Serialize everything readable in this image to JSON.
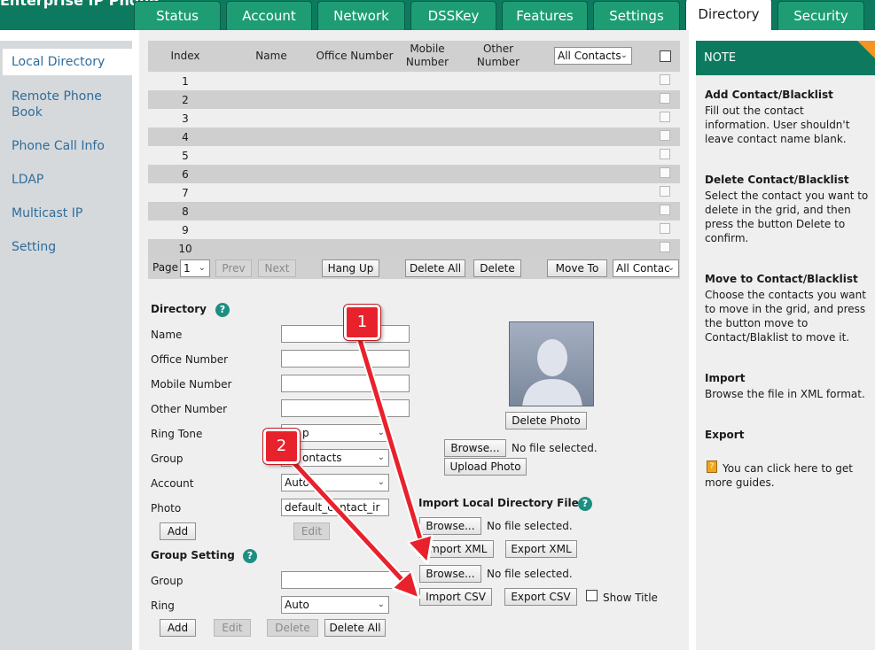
{
  "header": {
    "logo_text": "Enterprise IP Phone",
    "tabs": [
      "Status",
      "Account",
      "Network",
      "DSSKey",
      "Features",
      "Settings",
      "Directory",
      "Security"
    ],
    "active_tab": "Directory"
  },
  "sidebar": {
    "items": [
      "Local Directory",
      "Remote Phone Book",
      "Phone Call Info",
      "LDAP",
      "Multicast IP",
      "Setting"
    ],
    "active_item": "Local Directory"
  },
  "table": {
    "headers": [
      "Index",
      "Name",
      "Office Number",
      "Mobile Number",
      "Other Number"
    ],
    "filter_value": "All Contacts",
    "rows": [
      "1",
      "2",
      "3",
      "4",
      "5",
      "6",
      "7",
      "8",
      "9",
      "10"
    ]
  },
  "pager": {
    "page_label": "Page",
    "page_value": "1",
    "prev": "Prev",
    "next": "Next",
    "hang_up": "Hang Up",
    "delete_all": "Delete All",
    "delete": "Delete",
    "move_to": "Move To",
    "move_target": "All Contac"
  },
  "directory_form": {
    "title": "Directory",
    "fields": [
      "Name",
      "Office Number",
      "Mobile Number",
      "Other Number",
      "Ring Tone",
      "Group",
      "Account",
      "Photo"
    ],
    "ring_tone_value": "p",
    "group_value": "ontacts",
    "account_value": "Auto",
    "photo_value": "default_contact_ir",
    "add": "Add",
    "edit": "Edit"
  },
  "photo": {
    "delete_photo": "Delete Photo",
    "browse": "Browse...",
    "no_file": "No file selected.",
    "upload_photo": "Upload Photo"
  },
  "import_section": {
    "title": "Import Local Directory File",
    "browse": "Browse...",
    "no_file": "No file selected.",
    "import_xml": "Import XML",
    "export_xml": "Export XML",
    "import_csv": "Import CSV",
    "export_csv": "Export CSV",
    "show_title": "Show Title"
  },
  "group_setting": {
    "title": "Group Setting",
    "group_label": "Group",
    "ring_label": "Ring",
    "ring_value": "Auto",
    "add": "Add",
    "edit": "Edit",
    "delete": "Delete",
    "delete_all": "Delete All"
  },
  "note": {
    "header": "NOTE",
    "sections": [
      {
        "title": "Add Contact/Blacklist",
        "text": "Fill out the contact information. User shouldn't leave contact name blank."
      },
      {
        "title": "Delete Contact/Blacklist",
        "text": "Select the contact you want to delete in the grid, and then press the button Delete to confirm."
      },
      {
        "title": "Move to Contact/Blacklist",
        "text": "Choose the contacts you want to move in the grid, and press the button move to Contact/Blaklist to move it."
      },
      {
        "title": "Import",
        "text": "Browse the file in XML format."
      },
      {
        "title": "Export",
        "text": ""
      }
    ],
    "guide_text": "You can click here to get more guides."
  },
  "callouts": [
    "1",
    "2"
  ],
  "colors": {
    "header_bg": "#0d7a5f",
    "tab_bg": "#1e9d74",
    "callout_red": "#e8222c",
    "help_icon": "#1d8f82"
  }
}
